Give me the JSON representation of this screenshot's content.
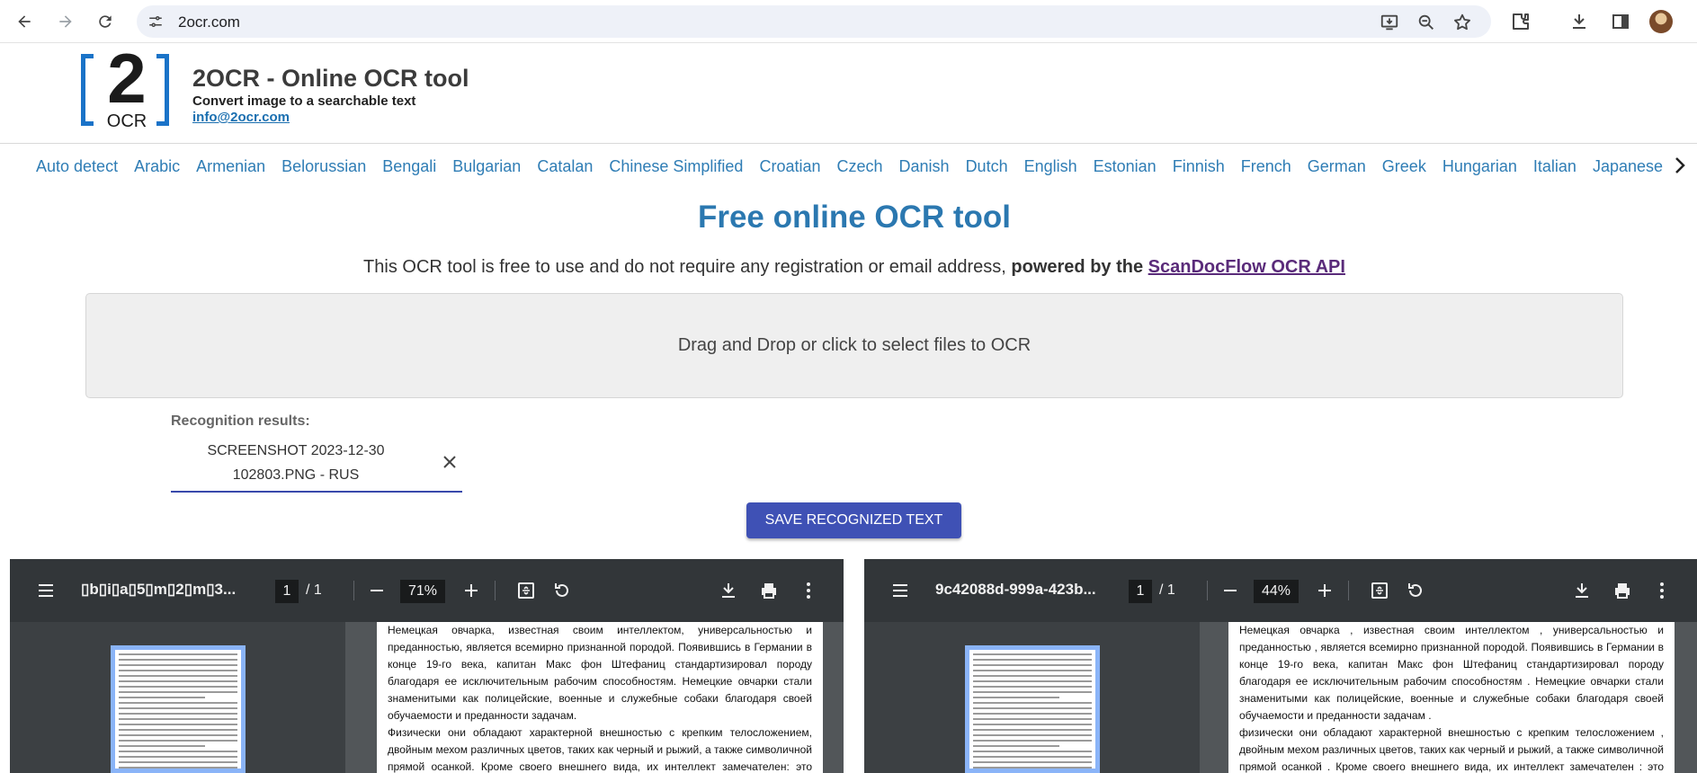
{
  "browser": {
    "url": "2ocr.com"
  },
  "header": {
    "logo_number": "2",
    "logo_text": "OCR",
    "title": "2OCR - Online OCR tool",
    "subtitle": "Convert image to a searchable text",
    "email": "info@2ocr.com"
  },
  "languages": [
    "Auto detect",
    "Arabic",
    "Armenian",
    "Belorussian",
    "Bengali",
    "Bulgarian",
    "Catalan",
    "Chinese Simplified",
    "Croatian",
    "Czech",
    "Danish",
    "Dutch",
    "English",
    "Estonian",
    "Finnish",
    "French",
    "German",
    "Greek",
    "Hungarian",
    "Italian",
    "Japanese"
  ],
  "main": {
    "title": "Free online OCR tool",
    "desc_plain": "This OCR tool is free to use and do not require any registration or email address, ",
    "desc_bold": "powered by the ",
    "desc_link": "ScanDocFlow OCR API",
    "dropzone_text": "Drag and Drop or click to select files to OCR",
    "results_label": "Recognition results:",
    "result_line1": "SCREENSHOT 2023-12-30",
    "result_line2": "102803.PNG - RUS",
    "save_button": "SAVE RECOGNIZED TEXT"
  },
  "viewer_left": {
    "title": "▯b▯i▯a▯5▯m▯2▯m▯3...",
    "page": "1",
    "page_total": "/ 1",
    "zoom": "71%",
    "text": [
      "Немецкая овчарка, известная своим интеллектом, универсальностью и преданностью, является всемирно признанной породой. Появившись в Германии в конце 19-го века, капитан Макс фон Штефаниц стандартизировал породу благодаря ее исключительным рабочим способностям. Немецкие овчарки стали знаменитыми как полицейские, военные и служебные собаки благодаря своей обучаемости и преданности задачам.",
      "Физически они обладают характерной внешностью с крепким телосложением, двойным мехом различных цветов, таких как черный и рыжий, а также символичной прямой осанкой. Кроме своего внешнего вида, их интеллект замечателен: это делает их способными выполнять различные роли - от поисковых работ до помощи лицам со слабым зрением или"
    ]
  },
  "viewer_right": {
    "title": "9c42088d-999a-423b...",
    "page": "1",
    "page_total": "/ 1",
    "zoom": "44%",
    "text": [
      "Немецкая овчарка , известная своим интеллектом , универсальностью и преданностью , является всемирно признанной породой. Появившись в Германии в конце 19-го века, капитан Макс фон Штефаниц стандартизировал породу благодаря ее исключительным рабочим способностям . Немецкие овчарки стали знаменитыми как полицейские, военные и служебные собаки благодаря своей обучаемости и преданности задачам .",
      "физически они обладают характерной внешностью с крепким телосложением , двойным мехом различных цветов, таких как черный и рыжий, а также символичной прямой осанкой . Кроме своего внешнего вида, их интеллект замечателен : это делает их способными выполнять различные роли - от поисковых работ до помощи лицам со слабым зрением или"
    ]
  }
}
